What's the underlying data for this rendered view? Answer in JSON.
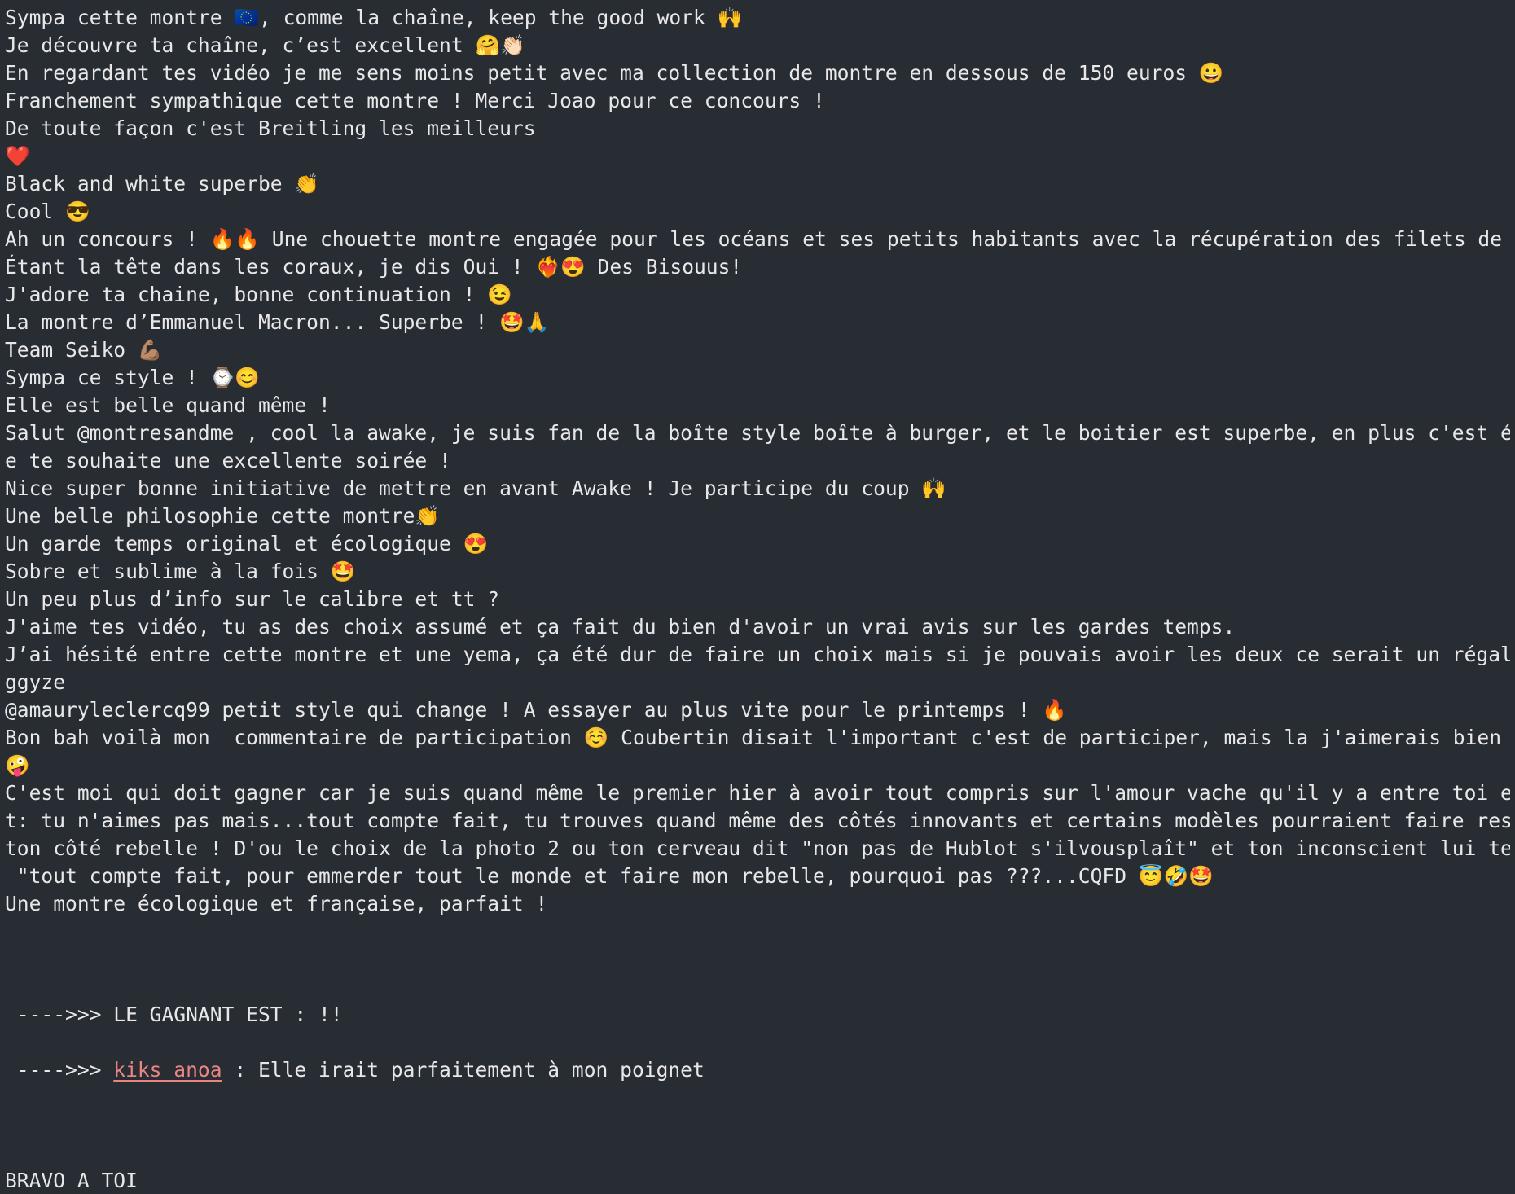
{
  "colors": {
    "background": "#282c33",
    "text": "#e8e8e8",
    "winner_link": "#e88484"
  },
  "lines": [
    "Sympa cette montre 🇪🇺, comme la chaîne, keep the good work 🙌",
    "Je découvre ta chaîne, c’est excellent 🤗👏🏻",
    "En regardant tes vidéo je me sens moins petit avec ma collection de montre en dessous de 150 euros 😀",
    "Franchement sympathique cette montre ! Merci Joao pour ce concours !",
    "De toute façon c'est Breitling les meilleurs",
    "❤️",
    "Black and white superbe 👏",
    "Cool 😎",
    "Ah un concours ! 🔥🔥 Une chouette montre engagée pour les océans et ses petits habitants avec la récupération des filets de pêche.",
    "Étant la tête dans les coraux, je dis Oui ! ❤️‍🔥😍 Des Bisouus!",
    "J'adore ta chaine, bonne continuation ! 😉",
    "La montre d’Emmanuel Macron... Superbe ! 🤩🙏",
    "Team Seiko 💪🏽",
    "Sympa ce style ! ⌚😊",
    "Elle est belle quand même !",
    "Salut @montresandme , cool la awake, je suis fan de la boîte style boîte à burger, et le boitier est superbe, en plus c'est écolo, j",
    "e te souhaite une excellente soirée !",
    "Nice super bonne initiative de mettre en avant Awake ! Je participe du coup 🙌",
    "Une belle philosophie cette montre👏",
    "Un garde temps original et écologique 😍",
    "Sobre et sublime à la fois 🤩",
    "Un peu plus d’info sur le calibre et tt ?",
    "J'aime tes vidéo, tu as des choix assumé et ça fait du bien d'avoir un vrai avis sur les gardes temps.",
    "J’ai hésité entre cette montre et une yema, ça été dur de faire un choix mais si je pouvais avoir les deux ce serait un régal 😍 @me",
    "ggyze",
    "@amauryleclercq99 petit style qui change ! A essayer au plus vite pour le printemps ! 🔥",
    "Bon bah voilà mon  commentaire de participation ☺️ Coubertin disait l'important c'est de participer, mais la j'aimerais bien gagner",
    "🤪",
    "C'est moi qui doit gagner car je suis quand même le premier hier à avoir tout compris sur l'amour vache qu'il y a entre toi et Hublo",
    "t: tu n'aimes pas mais...tout compte fait, tu trouves quand même des côtés innovants et certains modèles pourraient faire ressortir",
    "ton côté rebelle ! D'ou le choix de la photo 2 ou ton cerveau dit \"non pas de Hublot s'ilvousplaît\" et ton inconscient lui te répond",
    " \"tout compte fait, pour emmerder tout le monde et faire mon rebelle, pourquoi pas ???...CQFD 😇🤣🤩",
    "Une montre écologique et française, parfait !"
  ],
  "winner": {
    "announce": " ---->>> LE GAGNANT EST : !!",
    "prefix": " ---->>> ",
    "name": "kiks_anoa",
    "message": " : Elle irait parfaitement à mon poignet"
  },
  "footer": "BRAVO A TOI"
}
